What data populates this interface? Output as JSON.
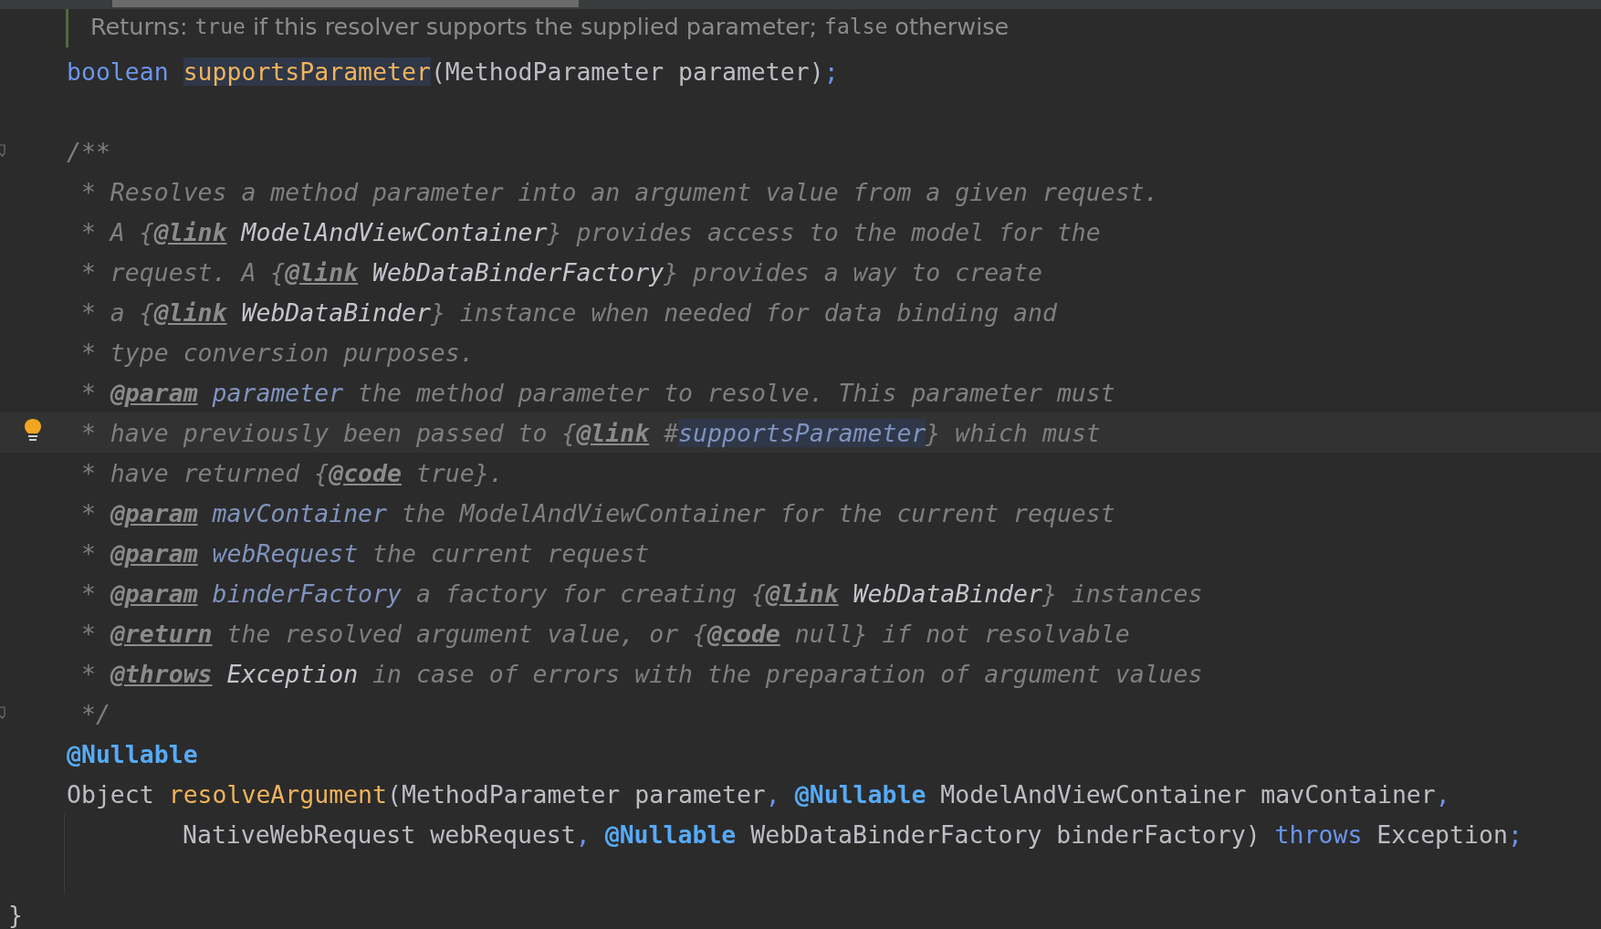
{
  "doc_popup": {
    "tokens": [
      {
        "kind": "text",
        "text": "Returns:"
      },
      {
        "kind": "code",
        "text": "true"
      },
      {
        "kind": "text",
        "text": "if this resolver supports the supplied parameter;"
      },
      {
        "kind": "code",
        "text": "false"
      },
      {
        "kind": "text",
        "text": "otherwise"
      }
    ]
  },
  "lines": [
    {
      "kind": "member",
      "tokens": [
        {
          "kind": "keyword",
          "text": "boolean"
        },
        {
          "kind": "method_usage",
          "text": "supportsParameter",
          "sp": true
        },
        {
          "kind": "plain",
          "text": "(MethodParameter parameter)"
        },
        {
          "kind": "punct",
          "text": ";"
        }
      ]
    },
    {
      "kind": "member"
    },
    {
      "kind": "member",
      "fold": true,
      "tokens": [
        {
          "kind": "comment",
          "text": "/**"
        }
      ]
    },
    {
      "kind": "member",
      "tokens": [
        {
          "kind": "comment",
          "text": " * Resolves a method parameter into an argument value from a given request."
        }
      ]
    },
    {
      "kind": "member",
      "tokens": [
        {
          "kind": "comment",
          "text": " * A {"
        },
        {
          "kind": "tag",
          "text": "@link"
        },
        {
          "kind": "ref",
          "text": "ModelAndViewContainer",
          "sp": true
        },
        {
          "kind": "comment",
          "text": "} provides access to the model for the"
        }
      ]
    },
    {
      "kind": "member",
      "tokens": [
        {
          "kind": "comment",
          "text": " * request. A {"
        },
        {
          "kind": "tag",
          "text": "@link"
        },
        {
          "kind": "ref",
          "text": "WebDataBinderFactory",
          "sp": true
        },
        {
          "kind": "comment",
          "text": "} provides a way to create"
        }
      ]
    },
    {
      "kind": "member",
      "tokens": [
        {
          "kind": "comment",
          "text": " * a {"
        },
        {
          "kind": "tag",
          "text": "@link"
        },
        {
          "kind": "ref",
          "text": "WebDataBinder",
          "sp": true
        },
        {
          "kind": "comment",
          "text": "} instance when needed for data binding and"
        }
      ]
    },
    {
      "kind": "member",
      "tokens": [
        {
          "kind": "comment",
          "text": " * type conversion purposes."
        }
      ]
    },
    {
      "kind": "member",
      "tokens": [
        {
          "kind": "comment",
          "text": " * "
        },
        {
          "kind": "tag",
          "text": "@param"
        },
        {
          "kind": "param",
          "text": "parameter",
          "sp": true
        },
        {
          "kind": "comment",
          "text": " the method parameter to resolve. This parameter must"
        }
      ]
    },
    {
      "kind": "member",
      "current": true,
      "bulb": true,
      "tokens": [
        {
          "kind": "comment",
          "text": " * have previously been passed to {"
        },
        {
          "kind": "tag",
          "text": "@link"
        },
        {
          "kind": "comment",
          "text": " #"
        },
        {
          "kind": "ref_usage",
          "text": "supportsParameter"
        },
        {
          "kind": "comment",
          "text": "} which must"
        }
      ]
    },
    {
      "kind": "member",
      "tokens": [
        {
          "kind": "comment",
          "text": " * have returned {"
        },
        {
          "kind": "tag",
          "text": "@code"
        },
        {
          "kind": "comment",
          "text": " true}."
        }
      ]
    },
    {
      "kind": "member",
      "tokens": [
        {
          "kind": "comment",
          "text": " * "
        },
        {
          "kind": "tag",
          "text": "@param"
        },
        {
          "kind": "param",
          "text": "mavContainer",
          "sp": true
        },
        {
          "kind": "comment",
          "text": " the ModelAndViewContainer for the current request"
        }
      ]
    },
    {
      "kind": "member",
      "tokens": [
        {
          "kind": "comment",
          "text": " * "
        },
        {
          "kind": "tag",
          "text": "@param"
        },
        {
          "kind": "param",
          "text": "webRequest",
          "sp": true
        },
        {
          "kind": "comment",
          "text": " the current request"
        }
      ]
    },
    {
      "kind": "member",
      "tokens": [
        {
          "kind": "comment",
          "text": " * "
        },
        {
          "kind": "tag",
          "text": "@param"
        },
        {
          "kind": "param",
          "text": "binderFactory",
          "sp": true
        },
        {
          "kind": "comment",
          "text": " a factory for creating {"
        },
        {
          "kind": "tag",
          "text": "@link"
        },
        {
          "kind": "ref",
          "text": "WebDataBinder",
          "sp": true
        },
        {
          "kind": "comment",
          "text": "} instances"
        }
      ]
    },
    {
      "kind": "member",
      "tokens": [
        {
          "kind": "comment",
          "text": " * "
        },
        {
          "kind": "tag",
          "text": "@return"
        },
        {
          "kind": "comment",
          "text": " the resolved argument value, or {"
        },
        {
          "kind": "tag",
          "text": "@code"
        },
        {
          "kind": "comment",
          "text": " null} if not resolvable"
        }
      ]
    },
    {
      "kind": "member",
      "tokens": [
        {
          "kind": "comment",
          "text": " * "
        },
        {
          "kind": "tag",
          "text": "@throws"
        },
        {
          "kind": "ref",
          "text": "Exception",
          "sp": true
        },
        {
          "kind": "comment",
          "text": " in case of errors with the preparation of argument values"
        }
      ]
    },
    {
      "kind": "member",
      "fold": true,
      "tokens": [
        {
          "kind": "comment",
          "text": " */"
        }
      ]
    },
    {
      "kind": "member",
      "tokens": [
        {
          "kind": "annotation",
          "text": "@Nullable"
        }
      ]
    },
    {
      "kind": "member",
      "tokens": [
        {
          "kind": "plain",
          "text": "Object"
        },
        {
          "kind": "method",
          "text": "resolveArgument",
          "sp": true
        },
        {
          "kind": "plain",
          "text": "(MethodParameter parameter"
        },
        {
          "kind": "punct",
          "text": ","
        },
        {
          "kind": "annotation",
          "text": "@Nullable",
          "sp": true
        },
        {
          "kind": "plain",
          "text": "ModelAndViewContainer mavContainer",
          "sp": true
        },
        {
          "kind": "punct",
          "text": ","
        }
      ]
    },
    {
      "kind": "continuation",
      "tokens": [
        {
          "kind": "plain",
          "text": "NativeWebRequest webRequest"
        },
        {
          "kind": "punct",
          "text": ","
        },
        {
          "kind": "annotation",
          "text": "@Nullable",
          "sp": true
        },
        {
          "kind": "plain",
          "text": "WebDataBinderFactory binderFactory)",
          "sp": true
        },
        {
          "kind": "keyword",
          "text": "throws",
          "sp": true
        },
        {
          "kind": "plain",
          "text": "Exception",
          "sp": true
        },
        {
          "kind": "punct",
          "text": ";"
        }
      ]
    },
    {
      "kind": "continuation"
    },
    {
      "kind": "closing",
      "tokens": [
        {
          "kind": "plain",
          "text": "}"
        }
      ]
    }
  ]
}
